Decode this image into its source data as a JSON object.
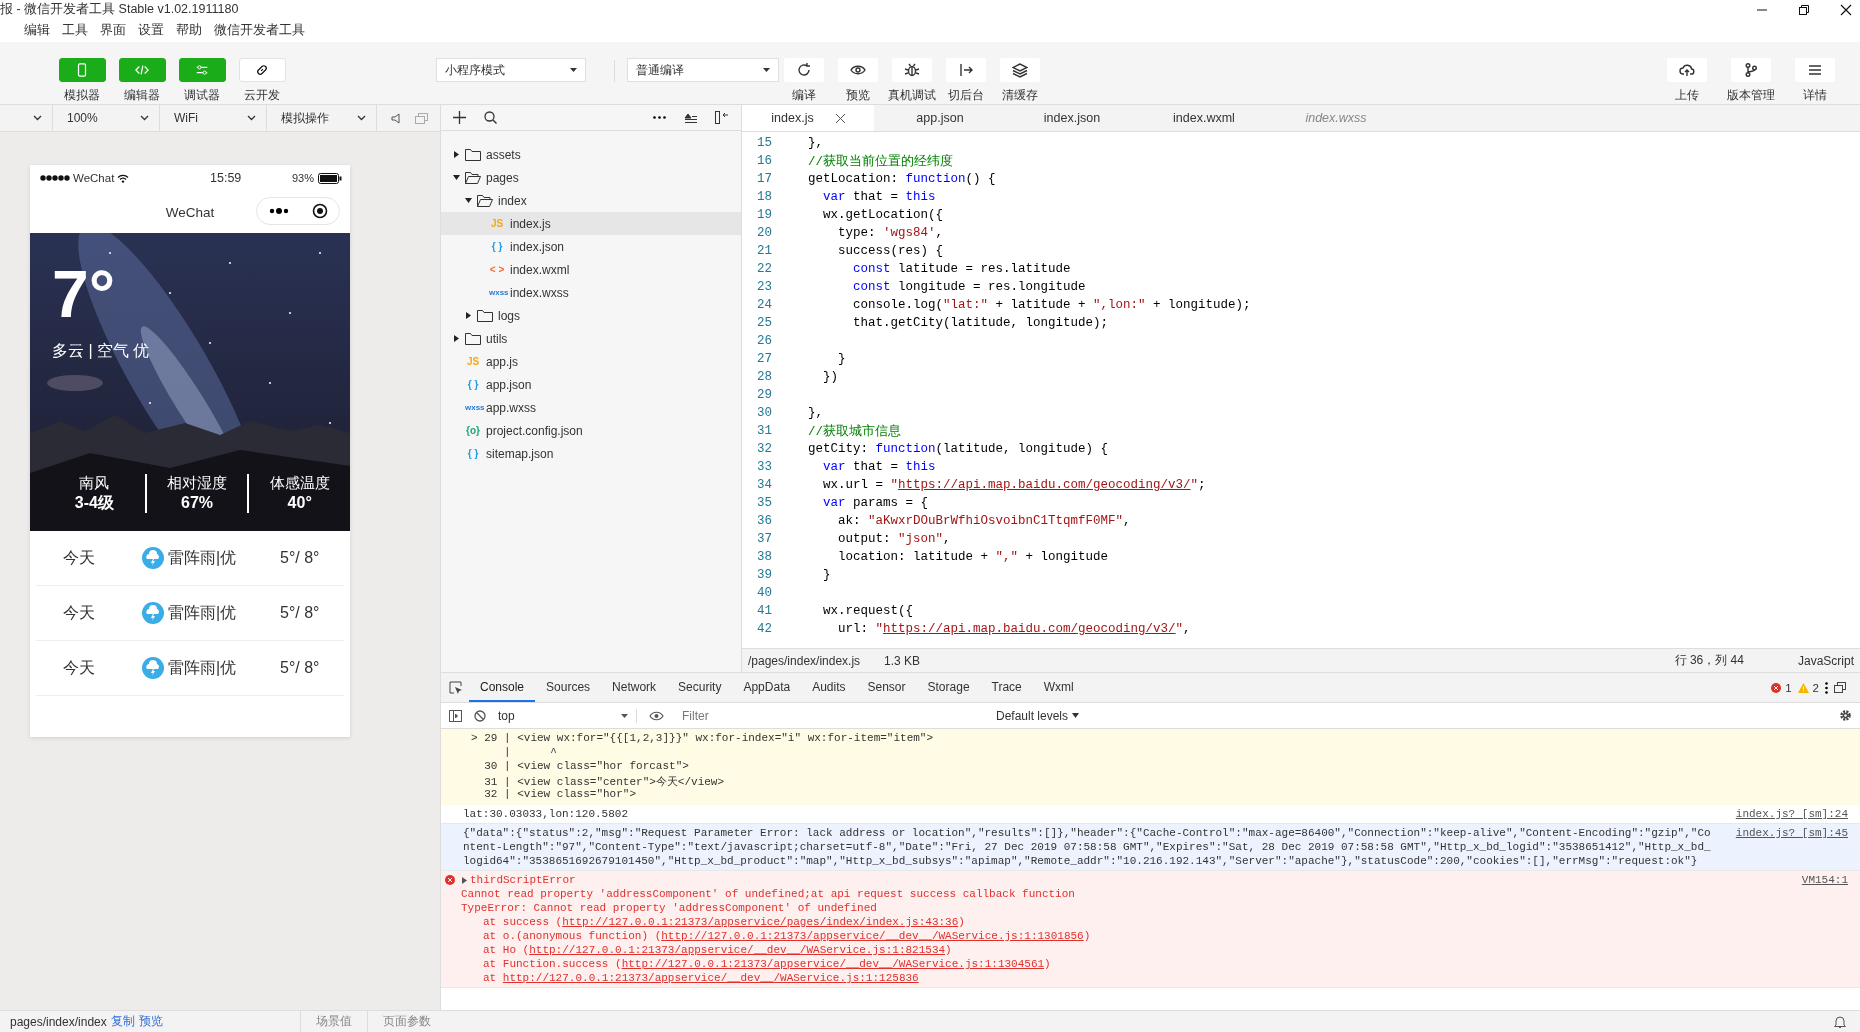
{
  "window": {
    "title": "报 - 微信开发者工具 Stable v1.02.1911180"
  },
  "menu": [
    "编辑",
    "工具",
    "界面",
    "设置",
    "帮助",
    "微信开发者工具"
  ],
  "toolbar": {
    "views": [
      {
        "label": "模拟器",
        "kind": "phone",
        "on": true
      },
      {
        "label": "编辑器",
        "kind": "code",
        "on": true
      },
      {
        "label": "调试器",
        "kind": "sliders",
        "on": true
      },
      {
        "label": "云开发",
        "kind": "link",
        "on": false
      }
    ],
    "mode_select": "小程序模式",
    "compile_select": "普通编译",
    "actions": [
      {
        "label": "编译",
        "kind": "refresh"
      },
      {
        "label": "预览",
        "kind": "eye"
      },
      {
        "label": "真机调试",
        "kind": "bug"
      },
      {
        "label": "切后台",
        "kind": "switch"
      },
      {
        "label": "清缓存",
        "kind": "layers"
      }
    ],
    "right_actions": [
      {
        "label": "上传",
        "kind": "upload"
      },
      {
        "label": "版本管理",
        "kind": "branch"
      },
      {
        "label": "详情",
        "kind": "menu"
      }
    ]
  },
  "simulator": {
    "zoom": "100%",
    "network": "WiFi",
    "operation": "模拟操作",
    "phone": {
      "carrier": "WeChat",
      "time": "15:59",
      "battery": "93%",
      "nav_title": "WeChat",
      "temperature": "7°",
      "condition": "多云 | 空气 优",
      "stats": [
        {
          "label": "南风",
          "value": "3-4级"
        },
        {
          "label": "相对湿度",
          "value": "67%"
        },
        {
          "label": "体感温度",
          "value": "40°"
        }
      ],
      "forecast": [
        {
          "day": "今天",
          "weather": "雷阵雨|优",
          "range": "5°/ 8°"
        },
        {
          "day": "今天",
          "weather": "雷阵雨|优",
          "range": "5°/ 8°"
        },
        {
          "day": "今天",
          "weather": "雷阵雨|优",
          "range": "5°/ 8°"
        }
      ]
    }
  },
  "file_tree": [
    {
      "name": "assets",
      "kind": "folder",
      "expanded": false,
      "selected": false
    },
    {
      "name": "pages",
      "kind": "folder",
      "expanded": true,
      "selected": false,
      "children": [
        {
          "name": "index",
          "kind": "folder",
          "expanded": true,
          "selected": false,
          "children": [
            {
              "name": "index.js",
              "kind": "js",
              "type_label": "JS",
              "selected": true
            },
            {
              "name": "index.json",
              "kind": "json",
              "type_label": "{ }",
              "selected": false
            },
            {
              "name": "index.wxml",
              "kind": "wxml",
              "type_label": "< >",
              "selected": false
            },
            {
              "name": "index.wxss",
              "kind": "wxss",
              "type_label": "wxss",
              "selected": false
            }
          ]
        },
        {
          "name": "logs",
          "kind": "folder",
          "expanded": false,
          "selected": false
        }
      ]
    },
    {
      "name": "utils",
      "kind": "folder",
      "expanded": false,
      "selected": false
    },
    {
      "name": "app.js",
      "kind": "js",
      "type_label": "JS",
      "selected": false
    },
    {
      "name": "app.json",
      "kind": "json",
      "type_label": "{ }",
      "selected": false
    },
    {
      "name": "app.wxss",
      "kind": "wxss",
      "type_label": "wxss",
      "selected": false
    },
    {
      "name": "project.config.json",
      "kind": "config",
      "type_label": "{o}",
      "selected": false
    },
    {
      "name": "sitemap.json",
      "kind": "json",
      "type_label": "{ }",
      "selected": false
    }
  ],
  "editor": {
    "tabs": [
      {
        "label": "index.js",
        "selected": true,
        "preview": false
      },
      {
        "label": "app.json",
        "selected": false,
        "preview": false
      },
      {
        "label": "index.json",
        "selected": false,
        "preview": false
      },
      {
        "label": "index.wxml",
        "selected": false,
        "preview": false
      },
      {
        "label": "index.wxss",
        "selected": false,
        "preview": true
      }
    ],
    "lines": [
      {
        "n": "15",
        "tokens": [
          {
            "kind": "plain",
            "text": "},"
          }
        ]
      },
      {
        "n": "16",
        "tokens": [
          {
            "kind": "comment",
            "text": "//获取当前位置的经纬度"
          }
        ]
      },
      {
        "n": "17",
        "tokens": [
          {
            "kind": "plain",
            "text": "getLocation: "
          },
          {
            "kind": "keyword",
            "text": "function"
          },
          {
            "kind": "plain",
            "text": "() {"
          }
        ]
      },
      {
        "n": "18",
        "tokens": [
          {
            "kind": "keyword",
            "text": "  var"
          },
          {
            "kind": "plain",
            "text": " that = "
          },
          {
            "kind": "keyword",
            "text": "this"
          }
        ]
      },
      {
        "n": "19",
        "tokens": [
          {
            "kind": "plain",
            "text": "  wx.getLocation({"
          }
        ]
      },
      {
        "n": "20",
        "tokens": [
          {
            "kind": "plain",
            "text": "    type: "
          },
          {
            "kind": "string",
            "text": "'wgs84'"
          },
          {
            "kind": "plain",
            "text": ","
          }
        ]
      },
      {
        "n": "21",
        "tokens": [
          {
            "kind": "plain",
            "text": "    success(res) {"
          }
        ]
      },
      {
        "n": "22",
        "tokens": [
          {
            "kind": "keyword",
            "text": "      const"
          },
          {
            "kind": "plain",
            "text": " latitude = res.latitude"
          }
        ]
      },
      {
        "n": "23",
        "tokens": [
          {
            "kind": "keyword",
            "text": "      const"
          },
          {
            "kind": "plain",
            "text": " longitude = res.longitude"
          }
        ]
      },
      {
        "n": "24",
        "tokens": [
          {
            "kind": "plain",
            "text": "      console.log("
          },
          {
            "kind": "string",
            "text": "\"lat:\""
          },
          {
            "kind": "plain",
            "text": " + latitude + "
          },
          {
            "kind": "string",
            "text": "\",lon:\""
          },
          {
            "kind": "plain",
            "text": " + longitude);"
          }
        ]
      },
      {
        "n": "25",
        "tokens": [
          {
            "kind": "plain",
            "text": "      that.getCity(latitude, longitude);"
          }
        ]
      },
      {
        "n": "26"
      },
      {
        "n": "27",
        "tokens": [
          {
            "kind": "plain",
            "text": "    }"
          }
        ]
      },
      {
        "n": "28",
        "tokens": [
          {
            "kind": "plain",
            "text": "  })"
          }
        ]
      },
      {
        "n": "29"
      },
      {
        "n": "30",
        "tokens": [
          {
            "kind": "plain",
            "text": "},"
          }
        ]
      },
      {
        "n": "31",
        "tokens": [
          {
            "kind": "comment",
            "text": "//获取城市信息"
          }
        ]
      },
      {
        "n": "32",
        "tokens": [
          {
            "kind": "plain",
            "text": "getCity: "
          },
          {
            "kind": "keyword",
            "text": "function"
          },
          {
            "kind": "plain",
            "text": "(latitude, longitude) {"
          }
        ]
      },
      {
        "n": "33",
        "tokens": [
          {
            "kind": "keyword",
            "text": "  var"
          },
          {
            "kind": "plain",
            "text": " that = "
          },
          {
            "kind": "keyword",
            "text": "this"
          }
        ]
      },
      {
        "n": "34",
        "tokens": [
          {
            "kind": "plain",
            "text": "  wx.url = "
          },
          {
            "kind": "string",
            "text": "\""
          },
          {
            "kind": "link",
            "text": "https://api.map.baidu.com/geocoding/v3/"
          },
          {
            "kind": "string",
            "text": "\""
          },
          {
            "kind": "plain",
            "text": ";"
          }
        ]
      },
      {
        "n": "35",
        "tokens": [
          {
            "kind": "keyword",
            "text": "  var"
          },
          {
            "kind": "plain",
            "text": " params = {"
          }
        ]
      },
      {
        "n": "36",
        "tokens": [
          {
            "kind": "plain",
            "text": "    ak: "
          },
          {
            "kind": "string",
            "text": "\"aKwxrDOuBrWfhiOsvoibnC1TtqmfF0MF\""
          },
          {
            "kind": "plain",
            "text": ","
          }
        ]
      },
      {
        "n": "37",
        "tokens": [
          {
            "kind": "plain",
            "text": "    output: "
          },
          {
            "kind": "string",
            "text": "\"json\""
          },
          {
            "kind": "plain",
            "text": ","
          }
        ]
      },
      {
        "n": "38",
        "tokens": [
          {
            "kind": "plain",
            "text": "    location: latitude + "
          },
          {
            "kind": "string",
            "text": "\",\""
          },
          {
            "kind": "plain",
            "text": " + longitude"
          }
        ]
      },
      {
        "n": "39",
        "tokens": [
          {
            "kind": "plain",
            "text": "  }"
          }
        ]
      },
      {
        "n": "40"
      },
      {
        "n": "41",
        "tokens": [
          {
            "kind": "plain",
            "text": "  wx.request({"
          }
        ]
      },
      {
        "n": "42",
        "tokens": [
          {
            "kind": "plain",
            "text": "    url: "
          },
          {
            "kind": "string",
            "text": "\""
          },
          {
            "kind": "link",
            "text": "https://api.map.baidu.com/geocoding/v3/"
          },
          {
            "kind": "string",
            "text": "\""
          },
          {
            "kind": "plain",
            "text": ","
          }
        ]
      }
    ],
    "status": {
      "path": "/pages/index/index.js",
      "size": "1.3 KB",
      "position": "行 36，列 44",
      "language": "JavaScript"
    }
  },
  "devtools": {
    "tabs": [
      {
        "label": "Console",
        "selected": true
      },
      {
        "label": "Sources",
        "selected": false
      },
      {
        "label": "Network",
        "selected": false
      },
      {
        "label": "Security",
        "selected": false
      },
      {
        "label": "AppData",
        "selected": false
      },
      {
        "label": "Audits",
        "selected": false
      },
      {
        "label": "Sensor",
        "selected": false
      },
      {
        "label": "Storage",
        "selected": false
      },
      {
        "label": "Trace",
        "selected": false
      },
      {
        "label": "Wxml",
        "selected": false
      }
    ],
    "errors": "1",
    "warnings": "2",
    "context": "top",
    "filter": {
      "placeholder": "Filter"
    },
    "levels": "Default levels",
    "messages": [
      {
        "kind": "source",
        "lines": [
          "> 29 | <view wx:for=\"{{[1,2,3]}}\" wx:for-index=\"i\" wx:for-item=\"item\">",
          "     |      ^",
          "  30 | <view class=\"hor forcast\">",
          "  31 | <view class=\"center\">今天</view>",
          "  32 | <view class=\"hor\">"
        ]
      },
      {
        "kind": "log",
        "text": "lat:30.03033,lon:120.5802",
        "source": "index.js? [sm]:24"
      },
      {
        "kind": "object",
        "text": "{\"data\":{\"status\":2,\"msg\":\"Request Parameter Error: lack address or location\",\"results\":[]},\"header\":{\"Cache-Control\":\"max-age=86400\",\"Connection\":\"keep-alive\",\"Content-Encoding\":\"gzip\",\"Content-Length\":\"97\",\"Content-Type\":\"text/javascript;charset=utf-8\",\"Date\":\"Fri, 27 Dec 2019 07:58:58 GMT\",\"Expires\":\"Sat, 28 Dec 2019 07:58:58 GMT\",\"Http_x_bd_logid\":\"3538651412\",\"Http_x_bd_logid64\":\"3538651692679101450\",\"Http_x_bd_product\":\"map\",\"Http_x_bd_subsys\":\"apimap\",\"Remote_addr\":\"10.216.192.143\",\"Server\":\"apache\"},\"statusCode\":200,\"cookies\":[],\"errMsg\":\"request:ok\"}",
        "source": "index.js? [sm]:45"
      },
      {
        "kind": "error",
        "title": "thirdScriptError",
        "source": "VM154:1",
        "lines": [
          "Cannot read property 'addressComponent' of undefined;at api request success callback function",
          "TypeError: Cannot read property 'addressComponent' of undefined"
        ],
        "stack": [
          {
            "before": "at success (",
            "link": "http://127.0.0.1:21373/appservice/pages/index/index.js:43:36",
            "after": ")"
          },
          {
            "before": "at o.(anonymous function) (",
            "link": "http://127.0.0.1:21373/appservice/__dev__/WAService.js:1:1301856",
            "after": ")"
          },
          {
            "before": "at Ho (",
            "link": "http://127.0.0.1:21373/appservice/__dev__/WAService.js:1:821534",
            "after": ")"
          },
          {
            "before": "at Function.success (",
            "link": "http://127.0.0.1:21373/appservice/__dev__/WAService.js:1:1304561",
            "after": ")"
          },
          {
            "before": "at ",
            "link": "http://127.0.0.1:21373/appservice/__dev__/WAService.js:1:125836"
          }
        ]
      }
    ]
  },
  "status_bar": {
    "path": "pages/index/index",
    "links": [
      "复制",
      "预览"
    ],
    "buttons": [
      "场景值",
      "页面参数"
    ]
  }
}
